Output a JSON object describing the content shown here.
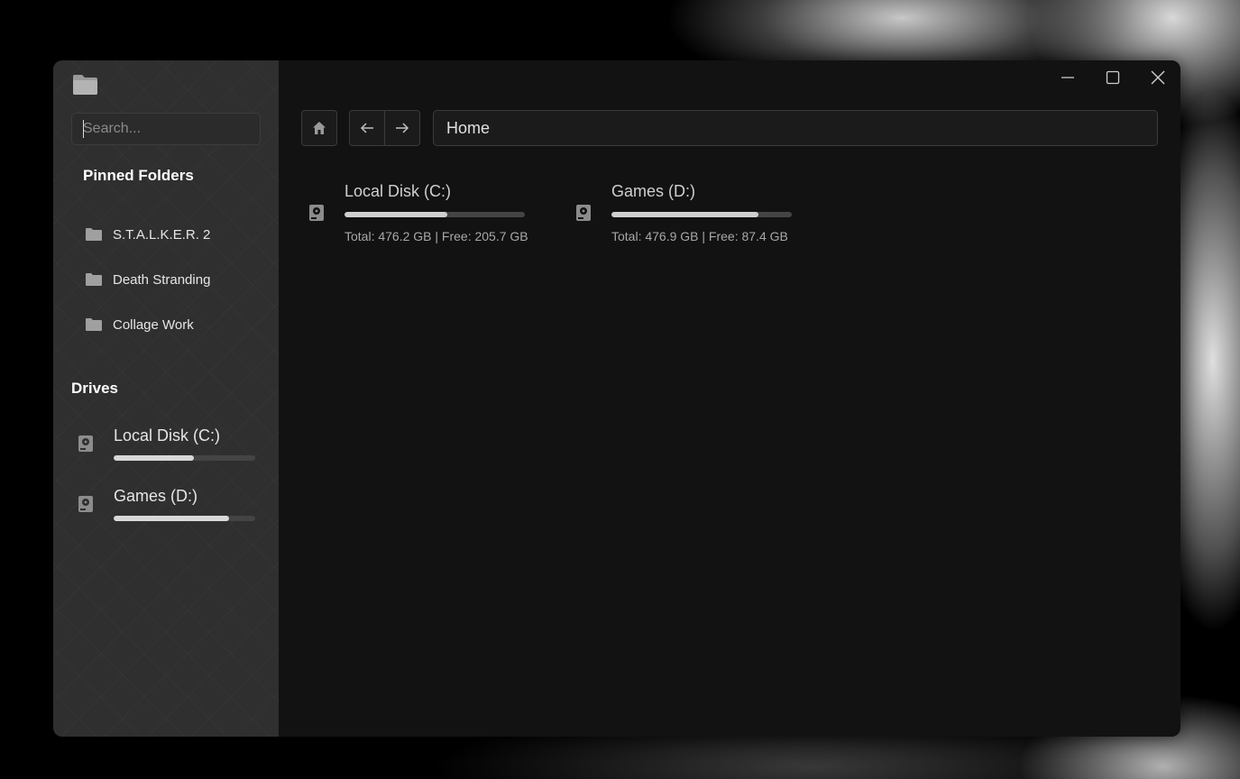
{
  "app": {
    "icon": "folder-icon",
    "window_controls": [
      "minimize-icon",
      "maximize-icon",
      "close-icon"
    ]
  },
  "sidebar": {
    "search": {
      "placeholder": "Search...",
      "value": ""
    },
    "pinned_title": "Pinned Folders",
    "pinned": [
      {
        "label": "S.T.A.L.K.E.R. 2",
        "icon": "folder-icon"
      },
      {
        "label": "Death Stranding",
        "icon": "folder-icon"
      },
      {
        "label": "Collage Work",
        "icon": "folder-icon"
      }
    ],
    "drives_title": "Drives",
    "drives": [
      {
        "name": "Local Disk (C:)",
        "icon": "hard-drive-icon",
        "used_fraction": 0.568
      },
      {
        "name": "Games (D:)",
        "icon": "hard-drive-icon",
        "used_fraction": 0.817
      }
    ]
  },
  "toolbar": {
    "home_icon": "home-icon",
    "back_icon": "arrow-left-icon",
    "forward_icon": "arrow-right-icon",
    "address": "Home"
  },
  "main": {
    "drives": [
      {
        "name": "Local Disk (C:)",
        "info": "Total: 476.2 GB | Free: 205.7 GB",
        "used_fraction": 0.568
      },
      {
        "name": "Games (D:)",
        "info": "Total: 476.9 GB | Free: 87.4 GB",
        "used_fraction": 0.817
      }
    ]
  },
  "colors": {
    "sidebar_bg": "#2f2f2f",
    "main_bg": "#121212",
    "bar_track": "#444444",
    "bar_fill": "#d8d8d8"
  }
}
